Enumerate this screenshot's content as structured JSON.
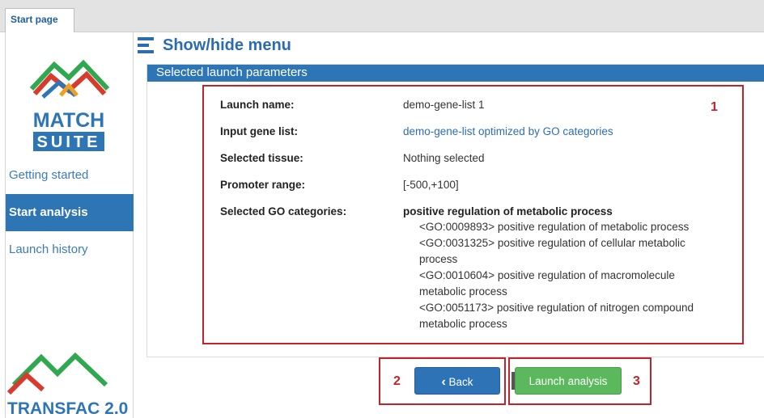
{
  "tabs": [
    {
      "label": "Start page"
    }
  ],
  "sidebar": {
    "logo_top_text_1": "MATCH",
    "logo_top_text_2": "SUITE",
    "items": [
      {
        "label": "Getting started"
      },
      {
        "label": "Start analysis"
      },
      {
        "label": "Launch history"
      }
    ],
    "logo_bottom_text": "TRANSFAC 2.0"
  },
  "header": {
    "title": "Show/hide menu"
  },
  "panel": {
    "title": "Selected launch parameters",
    "params": [
      {
        "label": "Launch name:",
        "value": "demo-gene-list 1"
      },
      {
        "label": "Input gene list:",
        "value": "demo-gene-list optimized by GO categories"
      },
      {
        "label": "Selected tissue:",
        "value": "Nothing selected"
      },
      {
        "label": "Promoter range:",
        "value": "[-500,+100]"
      },
      {
        "label": "Selected GO categories:",
        "value": "positive regulation of metabolic process"
      }
    ],
    "go_lines": [
      "<GO:0009893> positive regulation of metabolic process",
      "<GO:0031325> positive regulation of cellular metabolic",
      "process",
      "<GO:0010604> positive regulation of macromolecule",
      "metabolic process",
      "<GO:0051173> positive regulation of nitrogen compound",
      "metabolic process"
    ]
  },
  "buttons": {
    "back": "Back",
    "back_icon": "‹",
    "launch": "Launch analysis"
  },
  "annotations": {
    "n1": "1",
    "n2": "2",
    "n3": "3"
  },
  "colors": {
    "accent": "#2e75b6",
    "annotation": "#c0242a",
    "launch": "#5cb85c"
  }
}
